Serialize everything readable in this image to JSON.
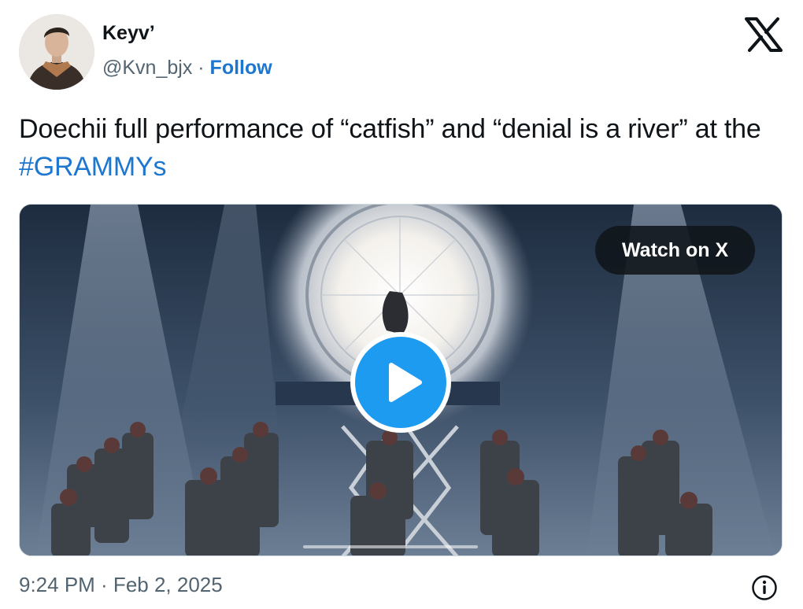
{
  "author": {
    "display_name": "Keyv’",
    "handle": "@Kvn_bjx",
    "separator": " · ",
    "follow_label": "Follow"
  },
  "tweet": {
    "text_before": "Doechii full performance of “catfish” and “denial is a river” at the ",
    "hashtag": "#GRAMMYs"
  },
  "media": {
    "type": "video",
    "watch_label": "Watch on X",
    "play_icon": "play-icon"
  },
  "footer": {
    "timestamp": "9:24 PM · Feb 2, 2025",
    "info_icon": "info-icon"
  },
  "colors": {
    "link": "#1d76cf",
    "play_button": "#1d9bf0",
    "secondary_text": "#536471"
  }
}
